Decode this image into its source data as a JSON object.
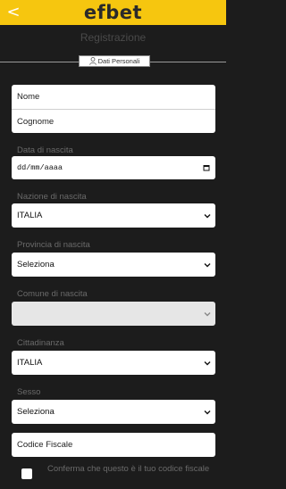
{
  "header": {
    "back_glyph": "<",
    "logo_text": "efbet",
    "brand_color": "#f6c60f"
  },
  "page": {
    "title": "Registrazione",
    "section_badge": "Dati Personali",
    "section_icon": "user-icon"
  },
  "form": {
    "nome_placeholder": "Nome",
    "cognome_placeholder": "Cognome",
    "birthdate_label": "Data di nascita",
    "birthdate_placeholder": "dd/mm/aaaa",
    "birth_nation_label": "Nazione di nascita",
    "birth_nation_value": "ITALIA",
    "birth_province_label": "Provincia di nascita",
    "birth_province_value": "Seleziona",
    "birth_city_label": "Comune di nascita",
    "birth_city_value": "",
    "citizenship_label": "Cittadinanza",
    "citizenship_value": "ITALIA",
    "sex_label": "Sesso",
    "sex_value": "Seleziona",
    "fiscal_code_placeholder": "Codice Fiscale",
    "confirm_fiscal_label": "Conferma che questo è il tuo codice fiscale"
  }
}
